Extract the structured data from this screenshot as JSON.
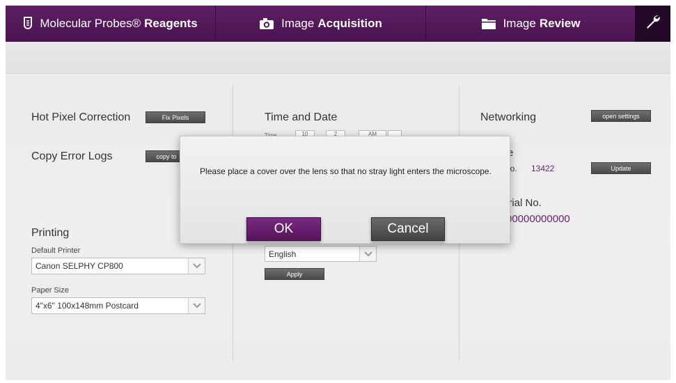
{
  "nav": {
    "reagents": {
      "prefix": "Molecular Probes®",
      "bold": "Reagents"
    },
    "acquisition": {
      "prefix": "Image",
      "bold": "Acquisition"
    },
    "review": {
      "prefix": "Image",
      "bold": "Review"
    }
  },
  "left": {
    "hot_pixel": {
      "title": "Hot Pixel Correction",
      "button": "Fix Pixels"
    },
    "error_logs": {
      "title": "Copy Error Logs",
      "button": "copy to"
    },
    "printing": {
      "title": "Printing",
      "default_printer_label": "Default Printer",
      "default_printer_value": "Canon SELPHY CP800",
      "paper_size_label": "Paper Size",
      "paper_size_value": "4\"x6\" 100x148mm Postcard"
    }
  },
  "middle": {
    "time_date": {
      "title": "Time and Date",
      "time_label": "Time",
      "hour": "10",
      "minute": "2",
      "ampm": "AM"
    },
    "language": {
      "value": "English",
      "apply": "Apply"
    }
  },
  "right": {
    "networking": {
      "title": "Networking",
      "button": "open settings"
    },
    "firmware": {
      "title_partial": "re",
      "version_label_partial": "No.",
      "version_value": "13422",
      "update": "Update"
    },
    "serial": {
      "title_partial": "erial No.",
      "value": "00000000000"
    }
  },
  "modal": {
    "message": "Please place a cover over the lens so that no stray light enters the microscope.",
    "ok": "OK",
    "cancel": "Cancel"
  },
  "colors": {
    "brand_purple": "#5e1f64",
    "accent_text": "#6a1f73"
  }
}
